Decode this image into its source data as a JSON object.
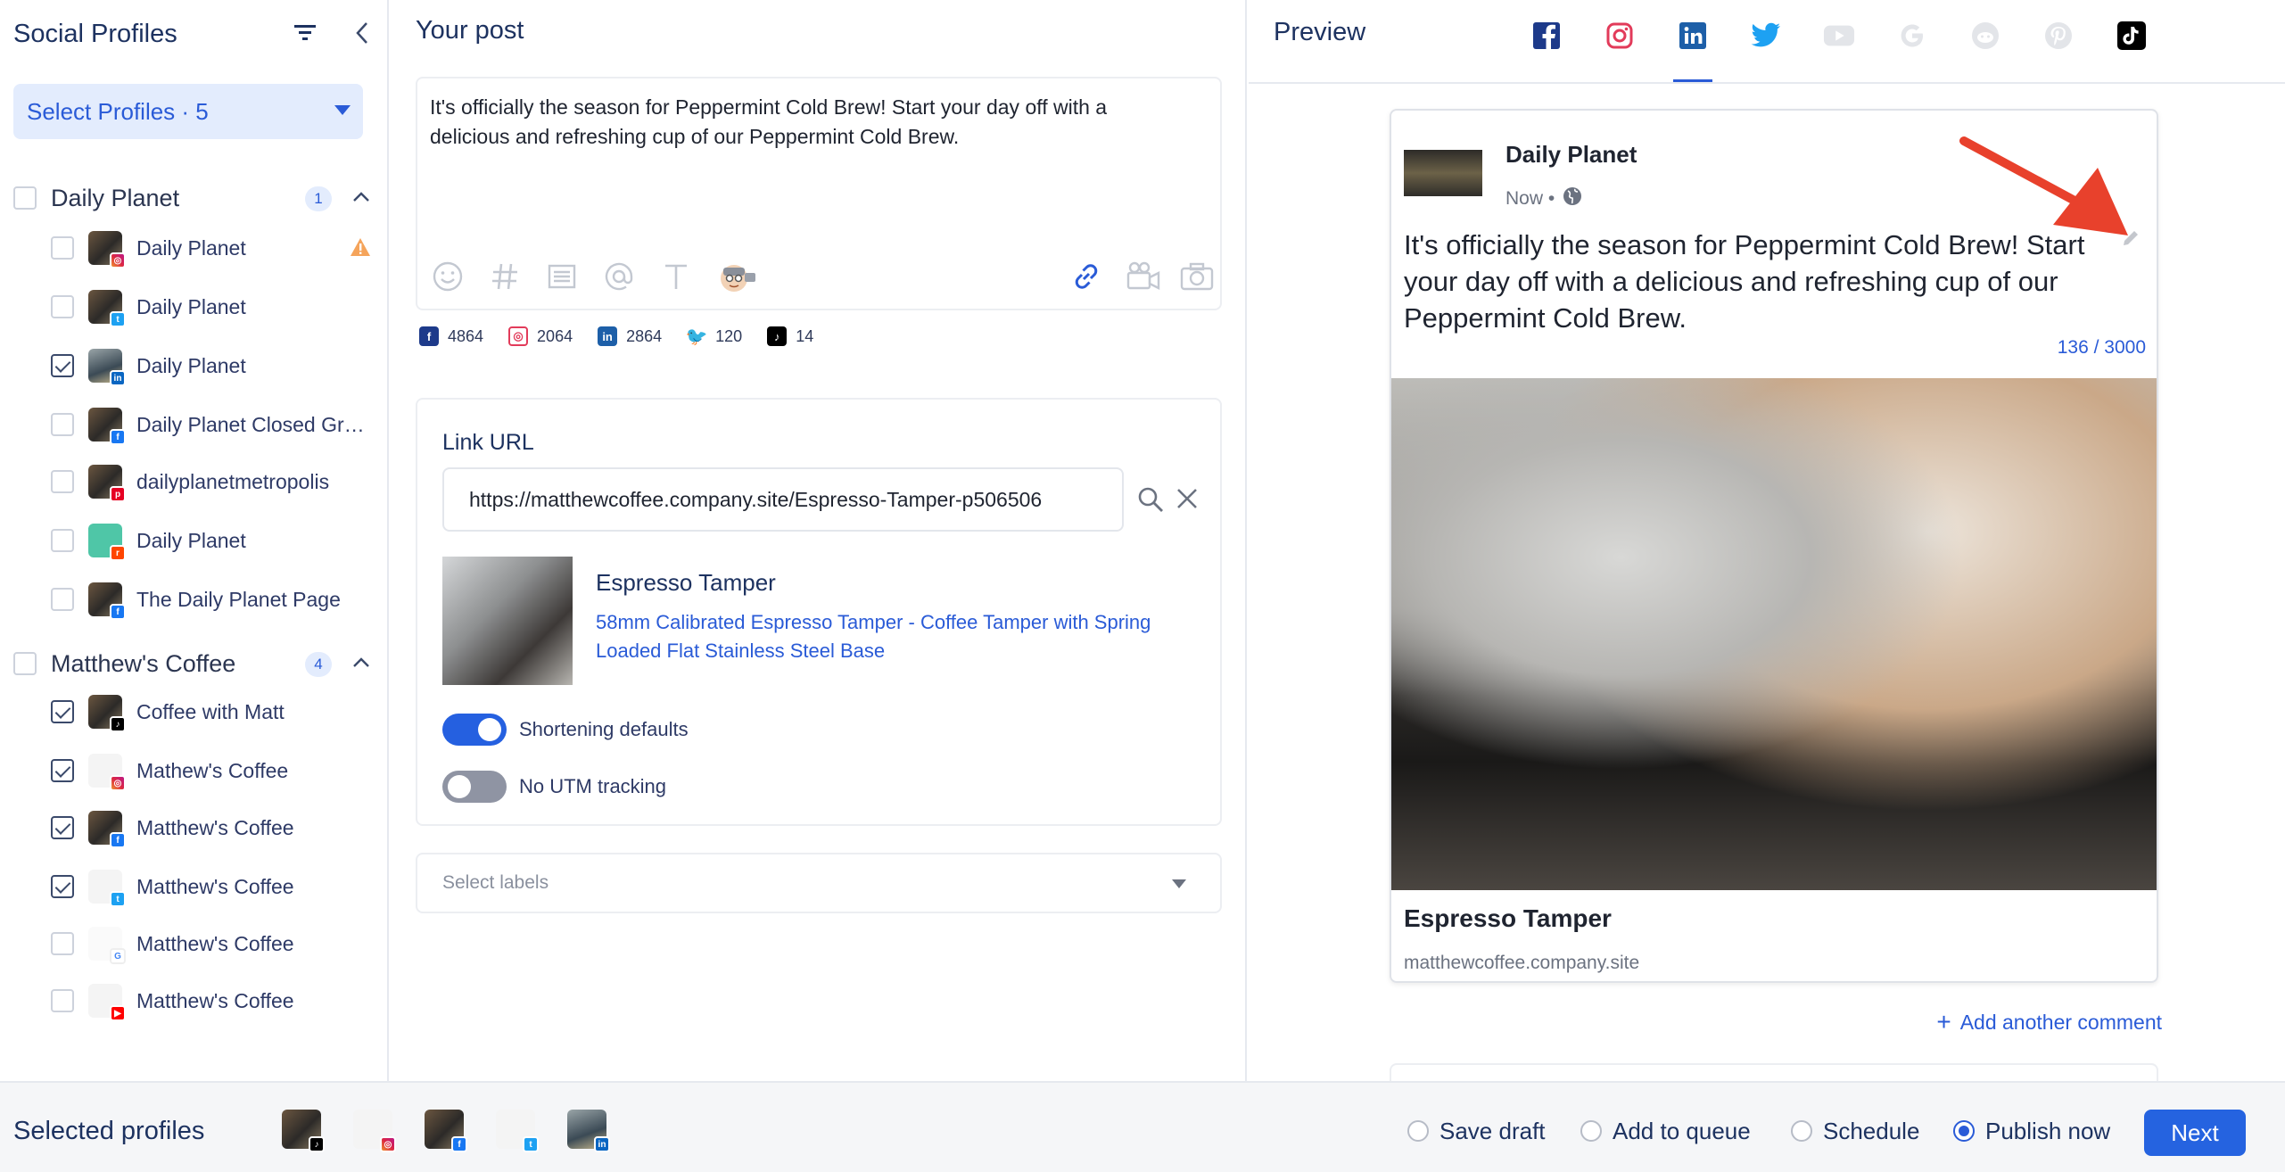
{
  "sidebar": {
    "title": "Social Profiles",
    "select_profiles": "Select Profiles · 5",
    "groups": [
      {
        "name": "Daily Planet",
        "count": "1",
        "profiles": [
          {
            "name": "Daily Planet",
            "network": "instagram",
            "checked": false,
            "warning": true
          },
          {
            "name": "Daily Planet",
            "network": "twitter",
            "checked": false
          },
          {
            "name": "Daily Planet",
            "network": "linkedin",
            "checked": true
          },
          {
            "name": "Daily Planet Closed Gro...",
            "network": "facebook",
            "checked": false
          },
          {
            "name": "dailyplanetmetropolis",
            "network": "pinterest",
            "checked": false
          },
          {
            "name": "Daily Planet",
            "network": "reddit",
            "checked": false
          },
          {
            "name": "The Daily Planet Page",
            "network": "facebook",
            "checked": false
          }
        ]
      },
      {
        "name": "Matthew's Coffee",
        "count": "4",
        "profiles": [
          {
            "name": "Coffee with Matt",
            "network": "tiktok",
            "checked": true
          },
          {
            "name": "Mathew's Coffee",
            "network": "instagram",
            "checked": true
          },
          {
            "name": "Matthew's Coffee",
            "network": "facebook",
            "checked": true
          },
          {
            "name": "Matthew's Coffee",
            "network": "twitter",
            "checked": true
          },
          {
            "name": "Matthew's Coffee",
            "network": "google",
            "checked": false
          },
          {
            "name": "Matthew's Coffee",
            "network": "youtube",
            "checked": false
          }
        ]
      }
    ]
  },
  "post": {
    "title": "Your post",
    "text": "It's officially the season for Peppermint Cold Brew! Start your day off with a delicious and refreshing cup of our Peppermint Cold Brew.",
    "counts": [
      {
        "network": "facebook",
        "value": "4864"
      },
      {
        "network": "instagram",
        "value": "2064"
      },
      {
        "network": "linkedin",
        "value": "2864"
      },
      {
        "network": "twitter",
        "value": "120"
      },
      {
        "network": "tiktok",
        "value": "14"
      }
    ],
    "link": {
      "label": "Link URL",
      "url": "https://matthewcoffee.company.site/Espresso-Tamper-p506506",
      "preview_title": "Espresso Tamper",
      "preview_desc": "58mm Calibrated Espresso Tamper - Coffee Tamper with Spring Loaded Flat Stainless Steel Base",
      "shortening_label": "Shortening defaults",
      "shortening_on": true,
      "utm_label": "No UTM tracking",
      "utm_on": false
    },
    "labels_placeholder": "Select labels"
  },
  "preview": {
    "title": "Preview",
    "active_network": "linkedin",
    "networks": [
      "facebook",
      "instagram",
      "linkedin",
      "twitter",
      "youtube",
      "google",
      "reddit",
      "pinterest",
      "tiktok"
    ],
    "account_name": "Daily Planet",
    "meta": "Now •",
    "text": "It's officially the season for Peppermint Cold Brew! Start your day off with a delicious and refreshing cup of our Peppermint Cold Brew.",
    "counter": "136 / 3000",
    "link_title": "Espresso Tamper",
    "link_domain": "matthewcoffee.company.site",
    "add_comment": "Add another comment"
  },
  "footer": {
    "title": "Selected profiles",
    "options": [
      {
        "label": "Save draft",
        "selected": false
      },
      {
        "label": "Add to queue",
        "selected": false
      },
      {
        "label": "Schedule",
        "selected": false
      },
      {
        "label": "Publish now",
        "selected": true
      }
    ],
    "next_label": "Next"
  },
  "colors": {
    "accent": "#2563e0",
    "heading": "#1d3260",
    "arrow": "#e8412c"
  }
}
